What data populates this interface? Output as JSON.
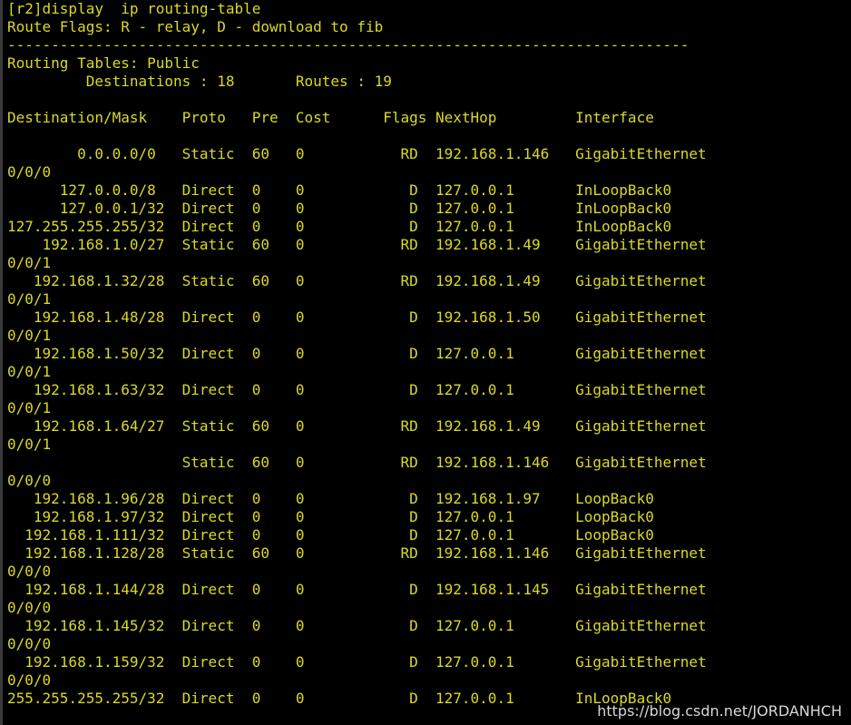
{
  "colors": {
    "background": "#000000",
    "text": "#d9d927",
    "watermark": "#d8d8d8"
  },
  "terminal": {
    "lines": [
      "[r2]display  ip routing-table",
      "Route Flags: R - relay, D - download to fib",
      "------------------------------------------------------------------------------",
      "Routing Tables: Public",
      "         Destinations : 18       Routes : 19",
      "",
      "Destination/Mask    Proto   Pre  Cost      Flags NextHop         Interface",
      "",
      "        0.0.0.0/0   Static  60   0           RD  192.168.1.146   GigabitEthernet",
      "0/0/0",
      "      127.0.0.0/8   Direct  0    0            D  127.0.0.1       InLoopBack0",
      "      127.0.0.1/32  Direct  0    0            D  127.0.0.1       InLoopBack0",
      "127.255.255.255/32  Direct  0    0            D  127.0.0.1       InLoopBack0",
      "    192.168.1.0/27  Static  60   0           RD  192.168.1.49    GigabitEthernet",
      "0/0/1",
      "   192.168.1.32/28  Static  60   0           RD  192.168.1.49    GigabitEthernet",
      "0/0/1",
      "   192.168.1.48/28  Direct  0    0            D  192.168.1.50    GigabitEthernet",
      "0/0/1",
      "   192.168.1.50/32  Direct  0    0            D  127.0.0.1       GigabitEthernet",
      "0/0/1",
      "   192.168.1.63/32  Direct  0    0            D  127.0.0.1       GigabitEthernet",
      "0/0/1",
      "   192.168.1.64/27  Static  60   0           RD  192.168.1.49    GigabitEthernet",
      "0/0/1",
      "                    Static  60   0           RD  192.168.1.146   GigabitEthernet",
      "0/0/0",
      "   192.168.1.96/28  Direct  0    0            D  192.168.1.97    LoopBack0",
      "   192.168.1.97/32  Direct  0    0            D  127.0.0.1       LoopBack0",
      "  192.168.1.111/32  Direct  0    0            D  127.0.0.1       LoopBack0",
      "  192.168.1.128/28  Static  60   0           RD  192.168.1.146   GigabitEthernet",
      "0/0/0",
      "  192.168.1.144/28  Direct  0    0            D  192.168.1.145   GigabitEthernet",
      "0/0/0",
      "  192.168.1.145/32  Direct  0    0            D  127.0.0.1       GigabitEthernet",
      "0/0/0",
      "  192.168.1.159/32  Direct  0    0            D  127.0.0.1       GigabitEthernet",
      "0/0/0",
      "255.255.255.255/32  Direct  0    0            D  127.0.0.1       InLoopBack0"
    ]
  },
  "watermark": "https://blog.csdn.net/JORDANHCH"
}
